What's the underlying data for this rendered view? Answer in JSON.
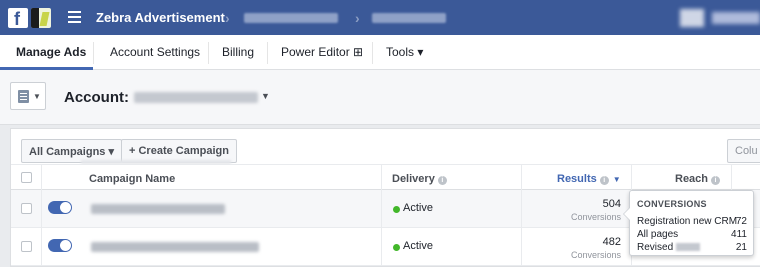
{
  "topbar": {
    "title": "Zebra Advertisement",
    "brand_color": "#3b5998",
    "logo_icon": "facebook-f-icon",
    "menu_icon": "hamburger-icon"
  },
  "tabs": [
    {
      "label": "Manage Ads",
      "active": true
    },
    {
      "label": "Account Settings"
    },
    {
      "label": "Billing"
    },
    {
      "label": "Power Editor ⊞"
    },
    {
      "label": "Tools ▾"
    }
  ],
  "account": {
    "label": "Account:"
  },
  "toolbar": {
    "all_campaigns": "All Campaigns ▾",
    "create_campaign": "+ Create Campaign",
    "columns": "Colu"
  },
  "table": {
    "headers": {
      "campaign_name": "Campaign Name",
      "delivery": "Delivery",
      "results": "Results",
      "reach": "Reach"
    },
    "rows": [
      {
        "status": "Active",
        "result": "504",
        "result_type": "Conversions"
      },
      {
        "status": "Active",
        "result": "482",
        "result_type": "Conversions"
      }
    ]
  },
  "tooltip": {
    "heading": "CONVERSIONS",
    "lines": [
      {
        "label": "Registration new CRM",
        "value": "72"
      },
      {
        "label": "All pages",
        "value": "411"
      },
      {
        "label": "Revised",
        "value": "21"
      }
    ]
  },
  "colors": {
    "accent": "#4267b2",
    "active_status": "#42b72a"
  }
}
